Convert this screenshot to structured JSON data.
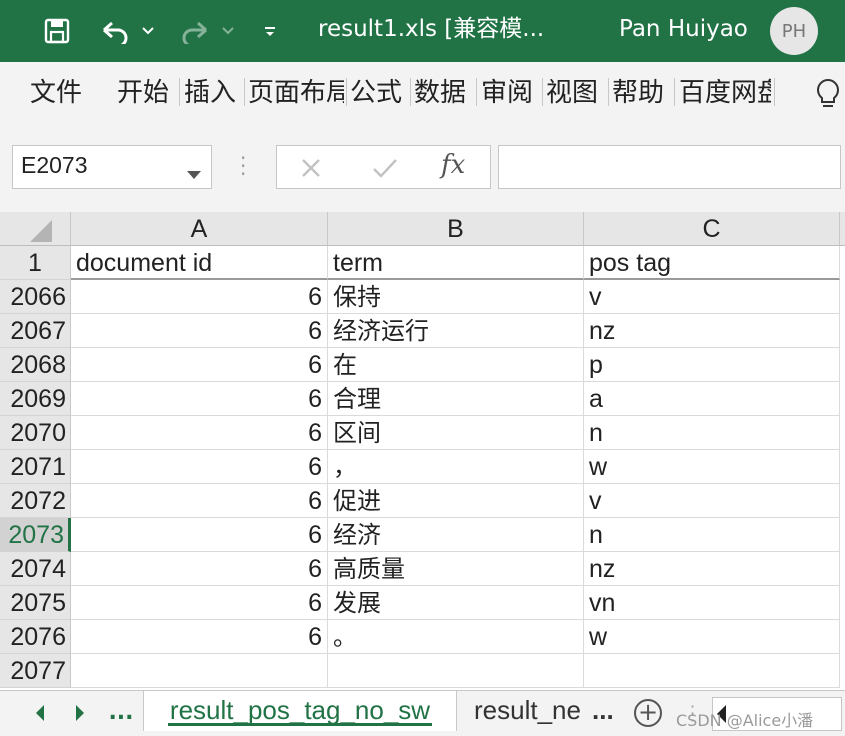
{
  "titlebar": {
    "title": "result1.xls  [兼容模...",
    "user_name": "Pan Huiyao",
    "avatar_initials": "PH",
    "accent": "#217346"
  },
  "ribbon": {
    "tabs": [
      "文件",
      "开始",
      "插入",
      "页面布局",
      "公式",
      "数据",
      "审阅",
      "视图",
      "帮助",
      "百度网盘"
    ]
  },
  "formula_bar": {
    "name_box": "E2073",
    "fx_label": "fx",
    "formula": ""
  },
  "grid": {
    "columns": [
      "A",
      "B",
      "C"
    ],
    "header_row": {
      "row": "1",
      "cells": [
        "document id",
        "term",
        "pos tag"
      ]
    },
    "rows": [
      {
        "row": "2066",
        "doc_id": "6",
        "term": "保持",
        "pos": "v"
      },
      {
        "row": "2067",
        "doc_id": "6",
        "term": "经济运行",
        "pos": "nz"
      },
      {
        "row": "2068",
        "doc_id": "6",
        "term": "在",
        "pos": "p"
      },
      {
        "row": "2069",
        "doc_id": "6",
        "term": "合理",
        "pos": "a"
      },
      {
        "row": "2070",
        "doc_id": "6",
        "term": "区间",
        "pos": "n"
      },
      {
        "row": "2071",
        "doc_id": "6",
        "term": "，",
        "pos": "w"
      },
      {
        "row": "2072",
        "doc_id": "6",
        "term": "促进",
        "pos": "v"
      },
      {
        "row": "2073",
        "doc_id": "6",
        "term": "经济",
        "pos": "n"
      },
      {
        "row": "2074",
        "doc_id": "6",
        "term": "高质量",
        "pos": "nz"
      },
      {
        "row": "2075",
        "doc_id": "6",
        "term": "发展",
        "pos": "vn"
      },
      {
        "row": "2076",
        "doc_id": "6",
        "term": "。",
        "pos": "w"
      },
      {
        "row": "2077",
        "doc_id": "",
        "term": "",
        "pos": ""
      }
    ],
    "active_row": "2073"
  },
  "sheets": {
    "nav_more": "...",
    "tabs": [
      "result_pos_tag_no_sw",
      "result_ne"
    ],
    "more": "...",
    "add_label": "+"
  },
  "watermark": "CSDN @Alice小潘"
}
